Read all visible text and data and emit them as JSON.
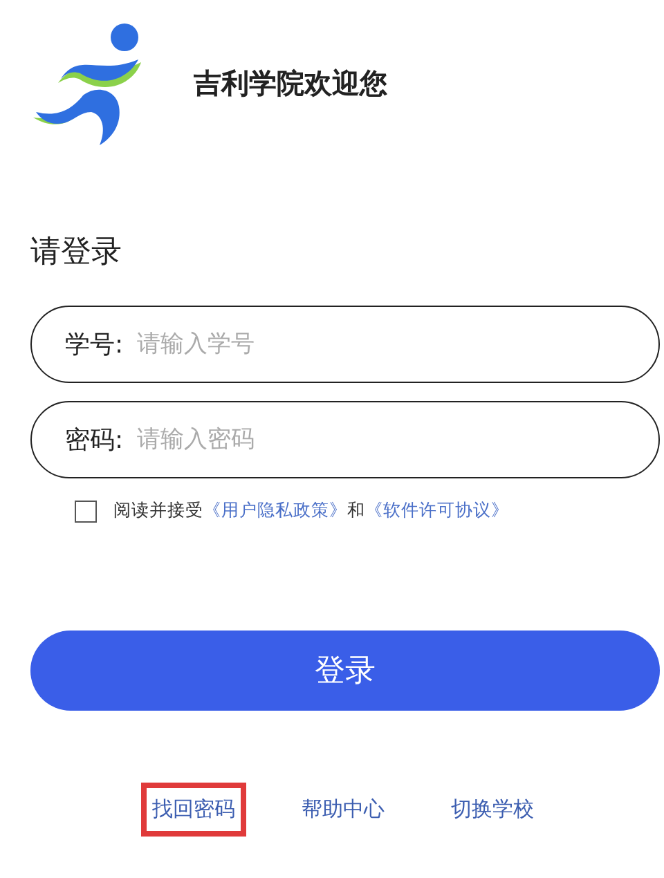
{
  "header": {
    "title": "吉利学院欢迎您"
  },
  "heading": "请登录",
  "fields": [
    {
      "label": "学号:",
      "placeholder": "请输入学号"
    },
    {
      "label": "密码:",
      "placeholder": "请输入密码"
    }
  ],
  "agreement": {
    "checked": false,
    "parts": [
      {
        "kind": "text",
        "text": "阅读并接受"
      },
      {
        "kind": "link",
        "text": "《用户隐私政策》"
      },
      {
        "kind": "text",
        "text": "和"
      },
      {
        "kind": "link",
        "text": "《软件许可协议》"
      }
    ]
  },
  "login_button": "登录",
  "links": [
    {
      "label": "找回密码",
      "highlighted": true
    },
    {
      "label": "帮助中心",
      "highlighted": false
    },
    {
      "label": "切换学校",
      "highlighted": false
    }
  ]
}
